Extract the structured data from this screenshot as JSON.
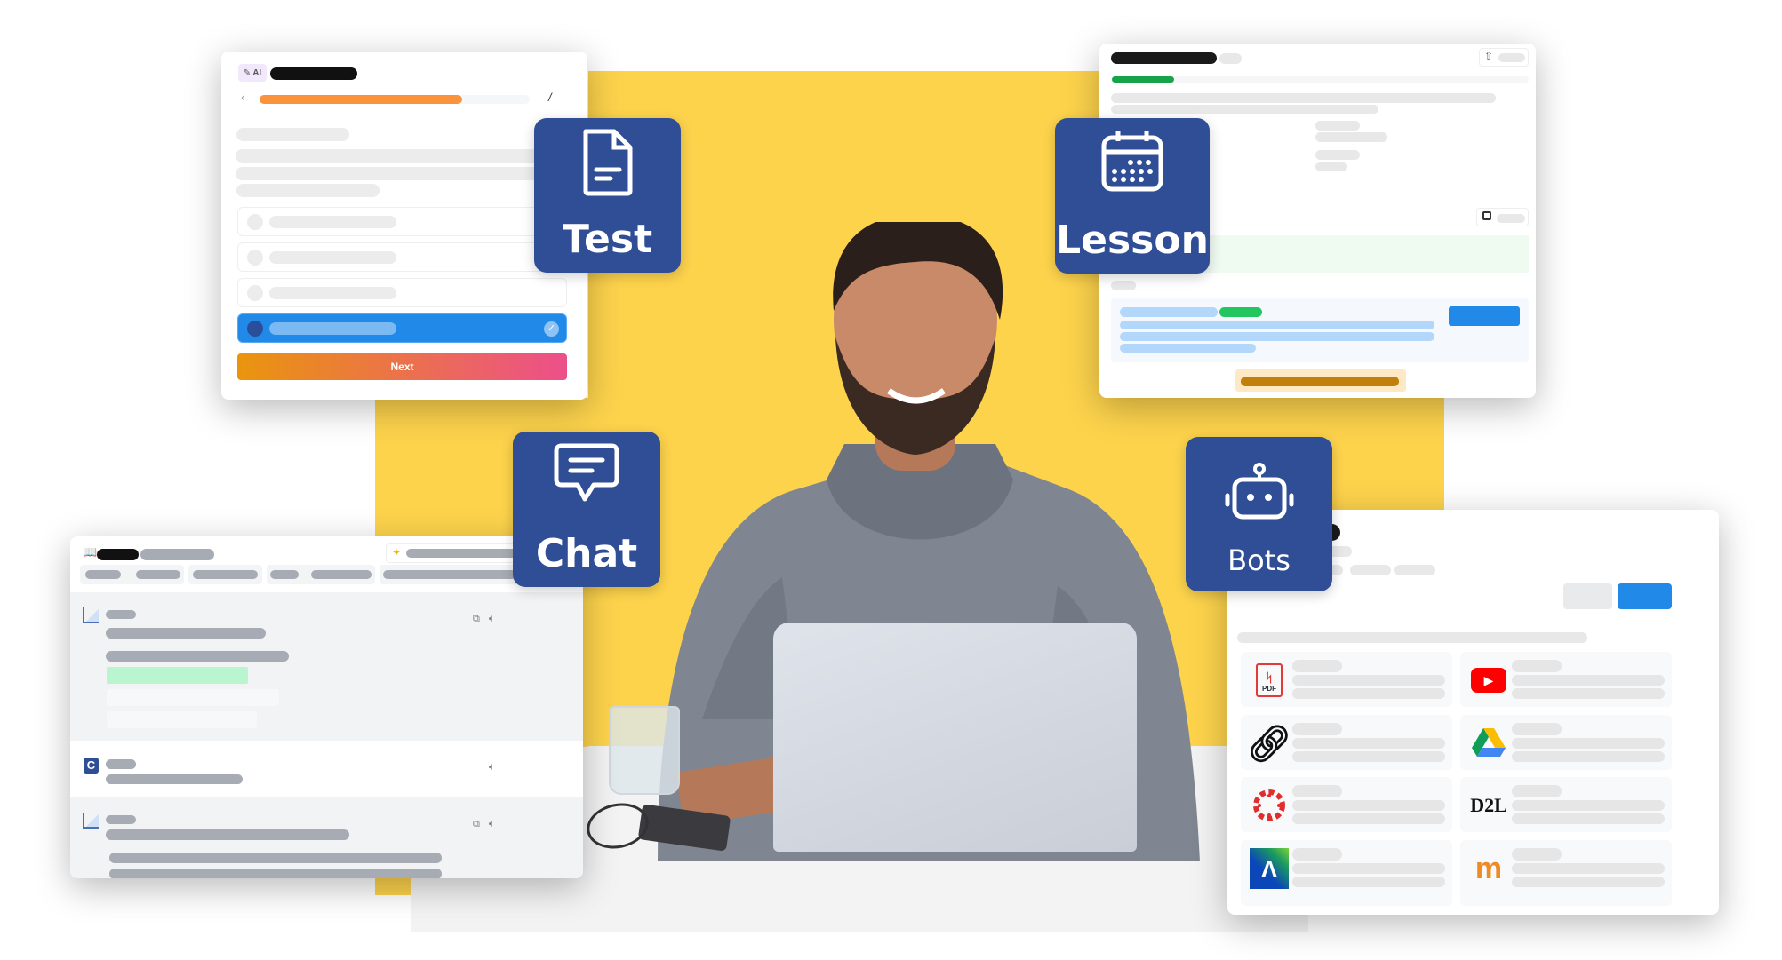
{
  "badges": {
    "test": "Test",
    "lesson": "Lesson",
    "chat": "Chat",
    "bots": "Bots"
  },
  "quiz": {
    "ai_label": "AI",
    "progress_percent": 75,
    "page_separator": "/",
    "next_label": "Next",
    "selected_option": 4
  },
  "lesson": {
    "progress_percent": 15
  },
  "chat": {
    "assistant_initial": "C"
  },
  "bots": {
    "sources": [
      {
        "name": "pdf-icon",
        "label": "PDF"
      },
      {
        "name": "youtube-icon",
        "label": ""
      },
      {
        "name": "link-icon",
        "label": ""
      },
      {
        "name": "google-drive-icon",
        "label": ""
      },
      {
        "name": "canvas-icon",
        "label": ""
      },
      {
        "name": "d2l-icon",
        "label": "D2L"
      },
      {
        "name": "schoology-icon",
        "label": ""
      },
      {
        "name": "moodle-icon",
        "label": ""
      }
    ]
  },
  "colors": {
    "brand_blue": "#2f4e96",
    "accent_yellow": "#fdd34c",
    "primary_blue": "#2189e8",
    "progress_orange": "#fb923c",
    "success_green": "#16a34a",
    "next_gradient_start": "#ea950d",
    "next_gradient_end": "#ec4f8a"
  }
}
